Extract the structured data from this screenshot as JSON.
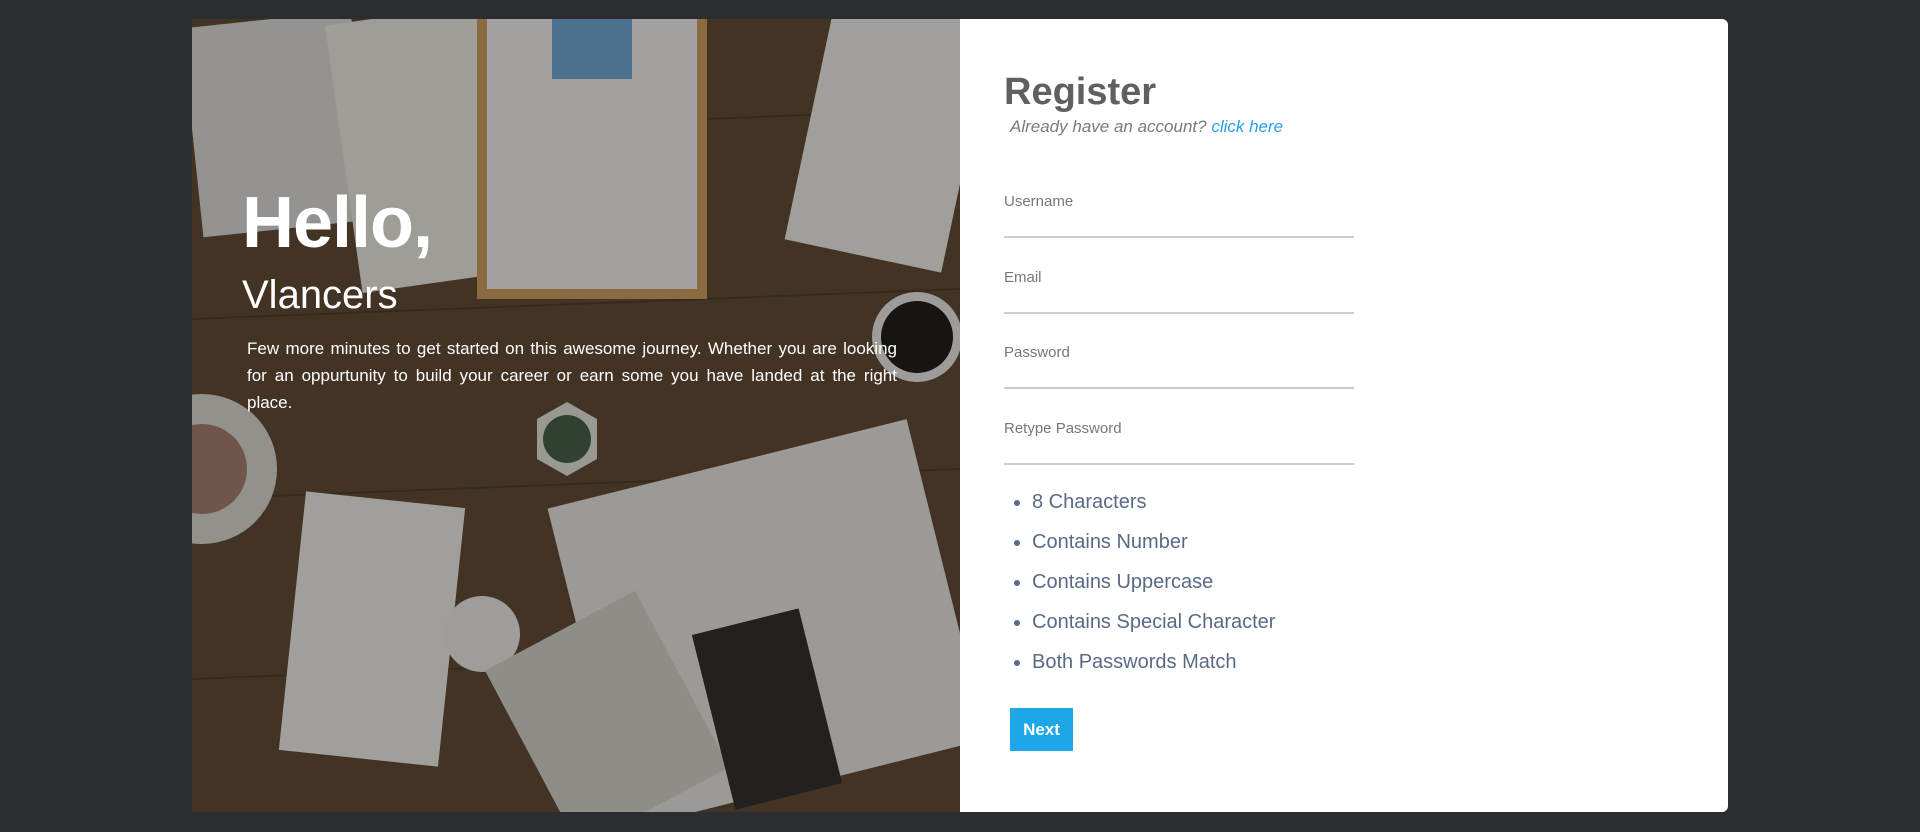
{
  "hero": {
    "greeting": "Hello,",
    "brand": "Vlancers",
    "blurb": "Few more minutes to get started on this awesome journey. Whether you are looking for an oppurtunity to build your career or earn some you have landed at the right place."
  },
  "form": {
    "title": "Register",
    "have_account": "Already have an account?",
    "click_here": "click here",
    "fields": [
      {
        "label": "Username",
        "value": ""
      },
      {
        "label": "Email",
        "value": ""
      },
      {
        "label": "Password",
        "value": ""
      },
      {
        "label": "Retype Password",
        "value": ""
      }
    ],
    "rules": [
      "8 Characters",
      "Contains Number",
      "Contains Uppercase",
      "Contains Special Character",
      "Both Passwords Match"
    ],
    "next_label": "Next"
  },
  "colors": {
    "page_bg": "#2c2d30",
    "accent": "#1da6e8",
    "link": "#2aa0e6",
    "rule_text": "#5a6a86"
  }
}
